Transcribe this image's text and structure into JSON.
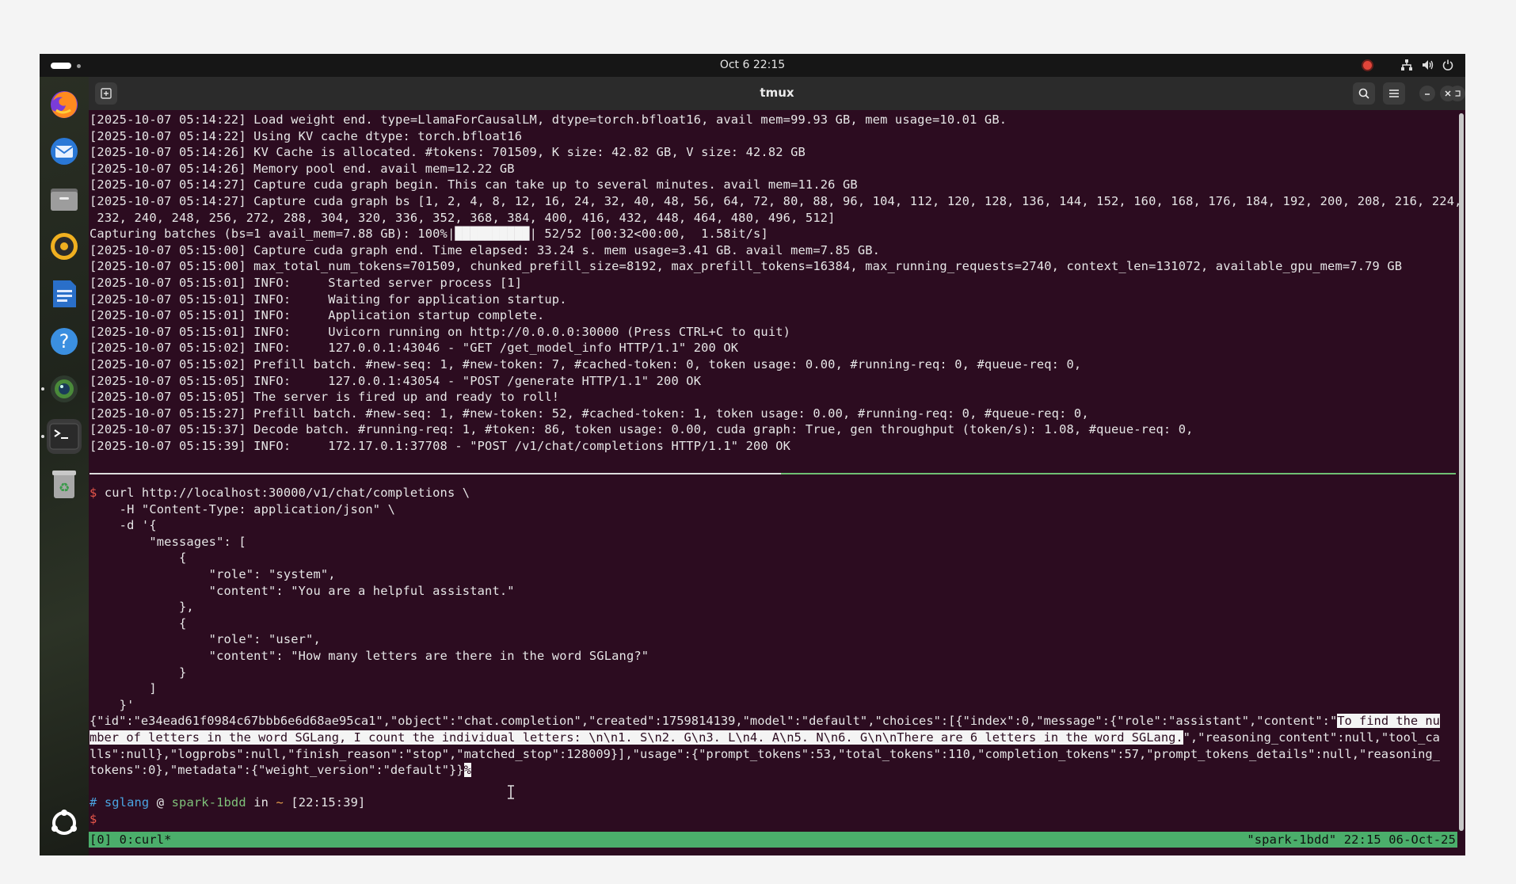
{
  "topbar": {
    "clock": "Oct 6  22:15"
  },
  "dock": {
    "items": [
      {
        "name": "firefox-icon",
        "color": "#e66000"
      },
      {
        "name": "thunderbird-icon",
        "color": "#2a78d6"
      },
      {
        "name": "files-icon",
        "color": "#8a8a8a"
      },
      {
        "name": "rhythmbox-icon",
        "color": "#f0b020"
      },
      {
        "name": "writer-icon",
        "color": "#2a6fc9"
      },
      {
        "name": "help-icon",
        "color": "#3b8fe0"
      },
      {
        "name": "camera-icon",
        "color": "#3a6b3a"
      },
      {
        "name": "terminal-icon",
        "color": "#333333"
      },
      {
        "name": "trash-icon",
        "color": "#9a9a9a"
      },
      {
        "name": "show-apps-icon",
        "color": "#ffffff"
      }
    ]
  },
  "window": {
    "title": "tmux"
  },
  "terminal": {
    "server_log": [
      "[2025-10-07 05:14:22] Load weight end. type=LlamaForCausalLM, dtype=torch.bfloat16, avail mem=99.93 GB, mem usage=10.01 GB.",
      "[2025-10-07 05:14:22] Using KV cache dtype: torch.bfloat16",
      "[2025-10-07 05:14:26] KV Cache is allocated. #tokens: 701509, K size: 42.82 GB, V size: 42.82 GB",
      "[2025-10-07 05:14:26] Memory pool end. avail mem=12.22 GB",
      "[2025-10-07 05:14:27] Capture cuda graph begin. This can take up to several minutes. avail mem=11.26 GB",
      "[2025-10-07 05:14:27] Capture cuda graph bs [1, 2, 4, 8, 12, 16, 24, 32, 40, 48, 56, 64, 72, 80, 88, 96, 104, 112, 120, 128, 136, 144, 152, 160, 168, 176, 184, 192, 200, 208, 216, 224,",
      " 232, 240, 248, 256, 272, 288, 304, 320, 336, 352, 368, 384, 400, 416, 432, 448, 464, 480, 496, 512]"
    ],
    "progress": {
      "prefix": "Capturing batches (bs=1 avail_mem=7.88 GB): 100%|",
      "bar": "██████████",
      "suffix": "| 52/52 [00:32<00:00,  1.58it/s]"
    },
    "server_log_2": [
      "[2025-10-07 05:15:00] Capture cuda graph end. Time elapsed: 33.24 s. mem usage=3.41 GB. avail mem=7.85 GB.",
      "[2025-10-07 05:15:00] max_total_num_tokens=701509, chunked_prefill_size=8192, max_prefill_tokens=16384, max_running_requests=2740, context_len=131072, available_gpu_mem=7.79 GB",
      "[2025-10-07 05:15:01] INFO:     Started server process [1]",
      "[2025-10-07 05:15:01] INFO:     Waiting for application startup.",
      "[2025-10-07 05:15:01] INFO:     Application startup complete.",
      "[2025-10-07 05:15:01] INFO:     Uvicorn running on http://0.0.0.0:30000 (Press CTRL+C to quit)",
      "[2025-10-07 05:15:02] INFO:     127.0.0.1:43046 - \"GET /get_model_info HTTP/1.1\" 200 OK",
      "[2025-10-07 05:15:02] Prefill batch. #new-seq: 1, #new-token: 7, #cached-token: 0, token usage: 0.00, #running-req: 0, #queue-req: 0,",
      "[2025-10-07 05:15:05] INFO:     127.0.0.1:43054 - \"POST /generate HTTP/1.1\" 200 OK",
      "[2025-10-07 05:15:05] The server is fired up and ready to roll!",
      "[2025-10-07 05:15:27] Prefill batch. #new-seq: 1, #new-token: 52, #cached-token: 1, token usage: 0.00, #running-req: 0, #queue-req: 0,",
      "[2025-10-07 05:15:37] Decode batch. #running-req: 1, #token: 86, token usage: 0.00, cuda graph: True, gen throughput (token/s): 1.08, #queue-req: 0,",
      "[2025-10-07 05:15:39] INFO:     172.17.0.1:37708 - \"POST /v1/chat/completions HTTP/1.1\" 200 OK"
    ],
    "prompt_symbol": "$",
    "command_first": " curl http://localhost:30000/v1/chat/completions \\",
    "command_lines": [
      "    -H \"Content-Type: application/json\" \\",
      "    -d '{",
      "        \"messages\": [",
      "            {",
      "                \"role\": \"system\",",
      "                \"content\": \"You are a helpful assistant.\"",
      "            },",
      "            {",
      "                \"role\": \"user\",",
      "                \"content\": \"How many letters are there in the word SGLang?\"",
      "            }",
      "        ]",
      "    }'"
    ],
    "response": {
      "line1_pre": "{\"id\":\"e34ead61f0984c67bbb6e6d68ae95ca1\",\"object\":\"chat.completion\",\"created\":1759814139,\"model\":\"default\",\"choices\":[{\"index\":0,\"message\":{\"role\":\"assistant\",\"content\":\"",
      "line1_hl": "To find the nu",
      "line2_hl": "mber of letters in the word SGLang, I count the individual letters: \\n\\n1. S\\n2. G\\n3. L\\n4. A\\n5. N\\n6. G\\n\\nThere are 6 letters in the word SGLang.",
      "line2_post": "\",\"reasoning_content\":null,\"tool_ca",
      "line3": "lls\":null},\"logprobs\":null,\"finish_reason\":\"stop\",\"matched_stop\":128009}],\"usage\":{\"prompt_tokens\":53,\"total_tokens\":110,\"completion_tokens\":57,\"prompt_tokens_details\":null,\"reasoning_",
      "line4": "tokens\":0},\"metadata\":{\"weight_version\":\"default\"}}",
      "line4_cursor": "%"
    },
    "prompt_info": {
      "hash": "#",
      "user": "sglang",
      "at": "@",
      "host": "spark-1bdd",
      "in": "in",
      "dir": "~",
      "time": "[22:15:39]"
    },
    "status_left": "[0] 0:curl*",
    "status_right": "\"spark-1bdd\" 22:15 06-Oct-25"
  }
}
